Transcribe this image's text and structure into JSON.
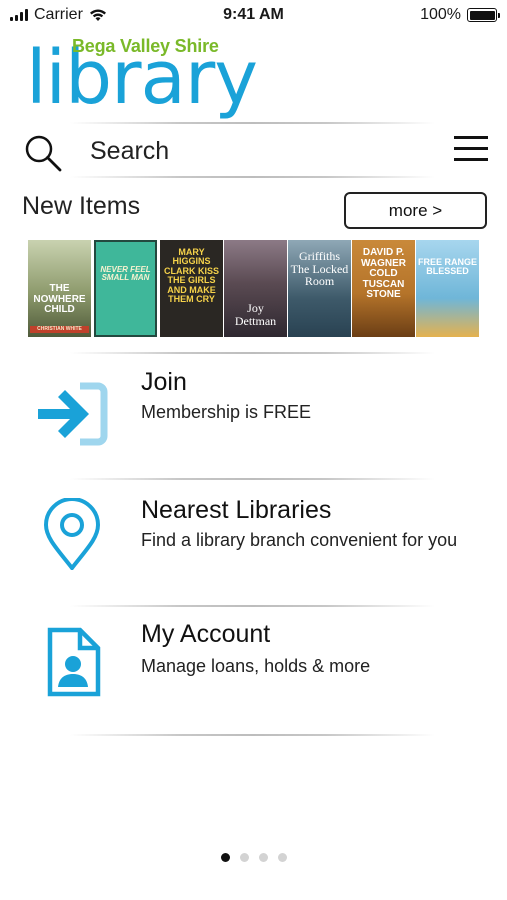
{
  "status_bar": {
    "carrier": "Carrier",
    "time": "9:41 AM",
    "battery": "100%",
    "battery_level": 1.0
  },
  "logo": {
    "tagline": "Bega Valley Shire",
    "wordmark": "library"
  },
  "search": {
    "placeholder": "Search"
  },
  "new_items": {
    "title": "New Items",
    "more_label": "more >",
    "books": [
      {
        "title": "THE NOWHERE CHILD",
        "author": "CHRISTIAN WHITE",
        "bg": "#8d9a6c"
      },
      {
        "title": "NEVER FEEL SMALL MAN",
        "author": "",
        "bg": "#3fb79a"
      },
      {
        "title": "MARY HIGGINS CLARK KISS THE GIRLS AND MAKE THEM CRY",
        "author": "",
        "bg": "#2a2723"
      },
      {
        "title": "Joy Dettman",
        "author": "",
        "bg": "#5a4a52"
      },
      {
        "title": "Griffiths The Locked Room",
        "author": "",
        "bg": "#3e5a6a"
      },
      {
        "title": "DAVID P. WAGNER COLD TUSCAN STONE",
        "author": "",
        "bg": "#b5742a"
      },
      {
        "title": "FREE RANGE BLESSED",
        "author": "",
        "bg": "#6fb6d8"
      }
    ]
  },
  "menu": [
    {
      "title": "Join",
      "subtitle": "Membership is FREE",
      "icon": "login-arrow-icon"
    },
    {
      "title": "Nearest Libraries",
      "subtitle": "Find a library branch convenient for you",
      "icon": "location-pin-icon"
    },
    {
      "title": "My Account",
      "subtitle": "Manage loans, holds & more",
      "icon": "account-card-icon"
    }
  ],
  "pagination": {
    "total": 4,
    "active": 1
  },
  "colors": {
    "brand_blue": "#1aa2d8",
    "brand_green": "#7ab929"
  }
}
